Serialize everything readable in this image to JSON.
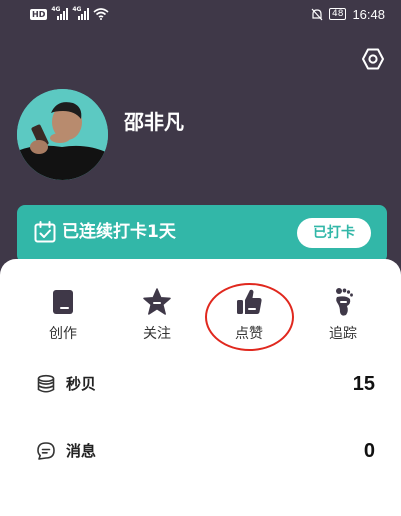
{
  "status_bar": {
    "left_tags": [
      "HD",
      "4G",
      "4G"
    ],
    "battery": "48",
    "time": "16:48"
  },
  "icons": {
    "settings": "gear-hex-icon",
    "checkin": "calendar-check-icon",
    "coins": "coins-stack-icon",
    "message": "chat-bubble-icon"
  },
  "profile": {
    "username": "邵非凡"
  },
  "checkin": {
    "text": "已连续打卡1天",
    "button_label": "已打卡"
  },
  "tabs": [
    {
      "label": "创作",
      "icon": "document-icon"
    },
    {
      "label": "关注",
      "icon": "star-icon"
    },
    {
      "label": "点赞",
      "icon": "thumbs-up-icon"
    },
    {
      "label": "追踪",
      "icon": "footprint-icon"
    }
  ],
  "stats": [
    {
      "label": "秒贝",
      "value": "15",
      "icon": "coins-stack-icon"
    },
    {
      "label": "消息",
      "value": "0",
      "icon": "chat-bubble-icon"
    }
  ],
  "colors": {
    "header_bg": "#3f3848",
    "accent": "#32b7a8",
    "highlight": "#e0281e",
    "icon_dark": "#3f3848"
  }
}
